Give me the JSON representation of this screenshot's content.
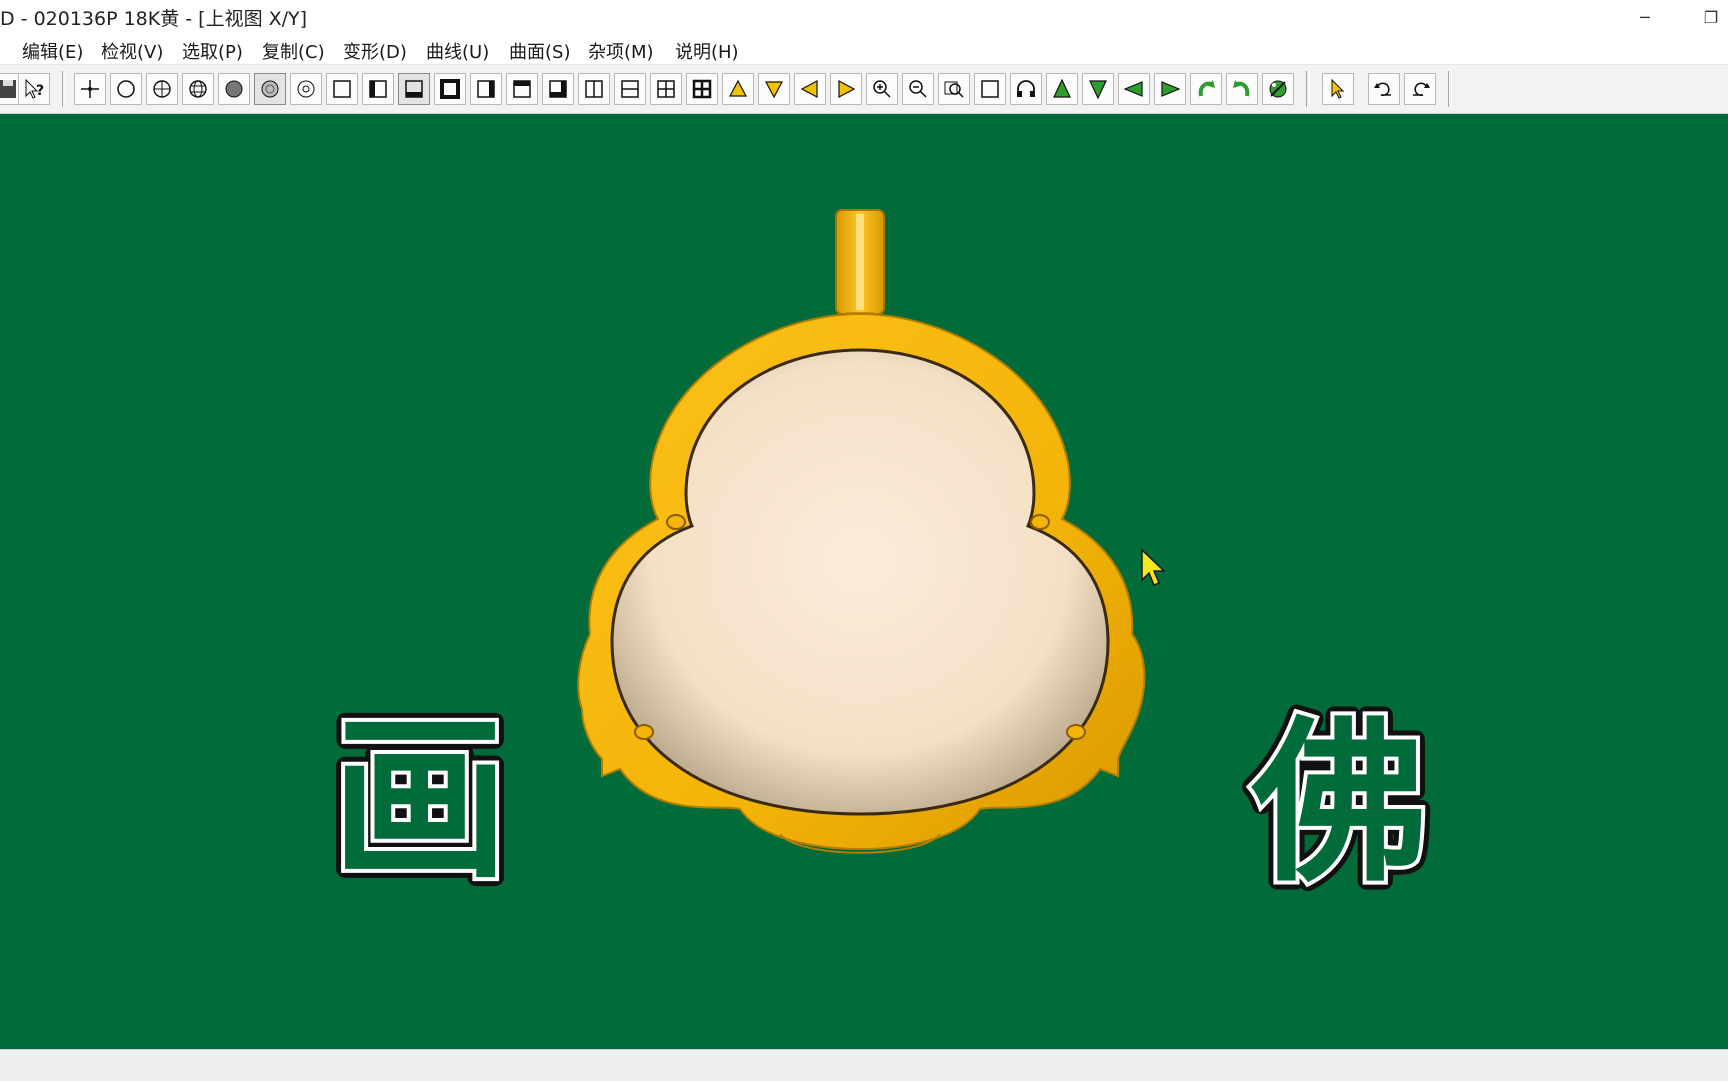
{
  "window": {
    "title": "D - 020136P 18K黄 - [上视图 X/Y]",
    "minimize_glyph": "─",
    "restore_glyph": "❐"
  },
  "menu": {
    "items": [
      "编辑(E)",
      "检视(V)",
      "选取(P)",
      "复制(C)",
      "变形(D)",
      "曲线(U)",
      "曲面(S)",
      "杂项(M)",
      "说明(H)"
    ]
  },
  "toolbar": {
    "buttons": [
      "save",
      "help",
      "point",
      "circle",
      "sphere-wire",
      "sphere-grid",
      "sphere-solid",
      "sphere-shaded",
      "sphere-render",
      "view-single",
      "view-left",
      "view-top",
      "view-front",
      "view-right",
      "view-top2",
      "view-bottom",
      "view-2col",
      "view-2row",
      "view-4a",
      "view-4b",
      "tri-up",
      "tri-down",
      "tri-left",
      "tri-right",
      "zoom-in",
      "zoom-out",
      "zoom-window",
      "zoom-all",
      "headphones",
      "rotate-up",
      "rotate-down",
      "rotate-left",
      "rotate-right",
      "rotate-cw",
      "rotate-ccw",
      "render-settings",
      "select-pointer",
      "undo",
      "redo"
    ],
    "pressed": [
      "sphere-shaded",
      "view-top"
    ]
  },
  "viewport": {
    "background": "#016b3a",
    "left_glyph": "画",
    "right_glyph": "佛",
    "pendant_gold": "#f4b409",
    "pendant_gold_dark": "#c98a00",
    "inlay_cream": "#fbe8d1",
    "cursor_color": "#f6ea1e"
  },
  "icons": {
    "cursor": "arrow-pointer-icon",
    "pendant": "gourd-pendant-icon"
  }
}
